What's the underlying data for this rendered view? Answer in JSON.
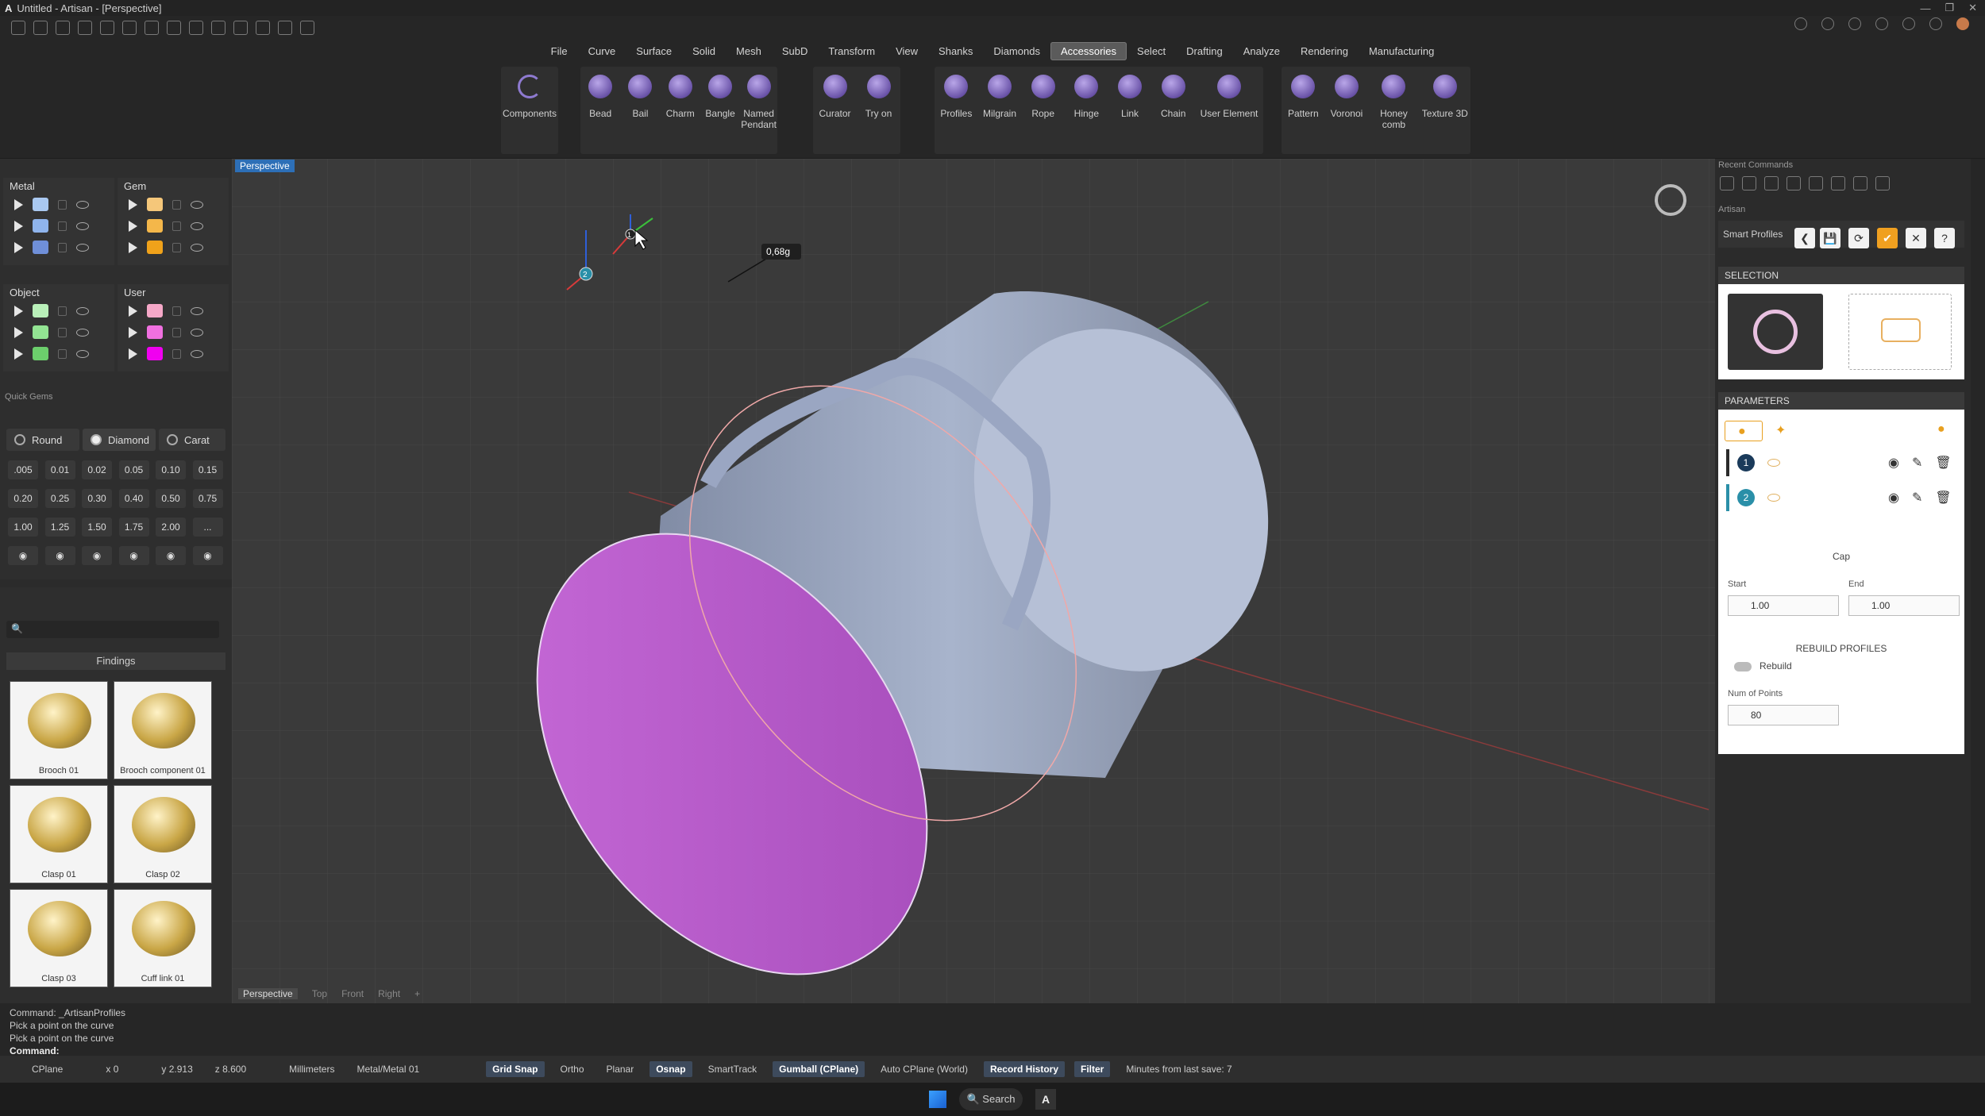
{
  "window": {
    "title": "Untitled - Artisan - [Perspective]"
  },
  "menu": [
    "File",
    "Curve",
    "Surface",
    "Solid",
    "Mesh",
    "SubD",
    "Transform",
    "View",
    "Shanks",
    "Diamonds",
    "Accessories",
    "Select",
    "Drafting",
    "Analyze",
    "Rendering",
    "Manufacturing"
  ],
  "menu_active": "Accessories",
  "ribbon": {
    "components": "Components",
    "bead": "Bead",
    "bail": "Bail",
    "charm": "Charm",
    "bangle": "Bangle",
    "named_pendant": "Named Pendant",
    "curator": "Curator",
    "try_on": "Try on",
    "profiles": "Profiles",
    "milgrain": "Milgrain",
    "rope": "Rope",
    "hinge": "Hinge",
    "link": "Link",
    "chain": "Chain",
    "user_element": "User Element",
    "pattern": "Pattern",
    "voronoi": "Voronoi",
    "honeycomb": "Honey comb",
    "texture3d": "Texture 3D"
  },
  "layers": {
    "metal": "Metal",
    "gem": "Gem",
    "object": "Object",
    "user": "User",
    "colors": {
      "metal": [
        "#a9c8f0",
        "#8fb4ec",
        "#6f8fd8"
      ],
      "gem": [
        "#f5c77a",
        "#f4b74a",
        "#f0a21a"
      ],
      "object": [
        "#b9f0b9",
        "#93e493",
        "#6ccf6c"
      ],
      "user": [
        "#f5a8c8",
        "#f070e0",
        "#f000f0"
      ]
    }
  },
  "quick_gems": {
    "title": "Quick Gems",
    "round": "Round",
    "diamond": "Diamond",
    "carat": "Carat",
    "sizes": [
      ".005",
      "0.01",
      "0.02",
      "0.05",
      "0.10",
      "0.15",
      "0.20",
      "0.25",
      "0.30",
      "0.40",
      "0.50",
      "0.75",
      "1.00",
      "1.25",
      "1.50",
      "1.75",
      "2.00",
      "..."
    ]
  },
  "library": {
    "category": "Findings",
    "items": [
      "Brooch 01",
      "Brooch component 01",
      "Clasp 01",
      "Clasp 02",
      "Clasp 03",
      "Cuff link 01"
    ]
  },
  "viewport": {
    "active": "Perspective",
    "tabs": [
      "Perspective",
      "Top",
      "Front",
      "Right"
    ],
    "weight_label": "0,68g",
    "point1": "1",
    "point2": "2"
  },
  "right": {
    "recent": "Recent Commands",
    "artisan": "Artisan",
    "smart_profiles": "Smart Profiles",
    "selection": "SELECTION",
    "parameters": "PARAMETERS",
    "profile1": "1",
    "profile2": "2",
    "cap": "Cap",
    "start": "Start",
    "end": "End",
    "start_val": "1.00",
    "end_val": "1.00",
    "rebuild_title": "REBUILD PROFILES",
    "rebuild": "Rebuild",
    "num_points": "Num of Points",
    "num_points_val": "80"
  },
  "command": {
    "line1": "Command: _ArtisanProfiles",
    "line2": "Pick a point on the curve",
    "line3": "Pick a point on the curve",
    "prompt": "Command:"
  },
  "status": {
    "cplane": "CPlane",
    "x": "x 0",
    "y": "y 2.913",
    "z": "z 8.600",
    "units": "Millimeters",
    "layer": "Metal/Metal 01",
    "grid_snap": "Grid Snap",
    "ortho": "Ortho",
    "planar": "Planar",
    "osnap": "Osnap",
    "smarttrack": "SmartTrack",
    "gumball": "Gumball (CPlane)",
    "auto_cplane": "Auto CPlane (World)",
    "record_history": "Record History",
    "filter": "Filter",
    "last_save": "Minutes from last save: 7"
  },
  "taskbar": {
    "search": "Search"
  }
}
